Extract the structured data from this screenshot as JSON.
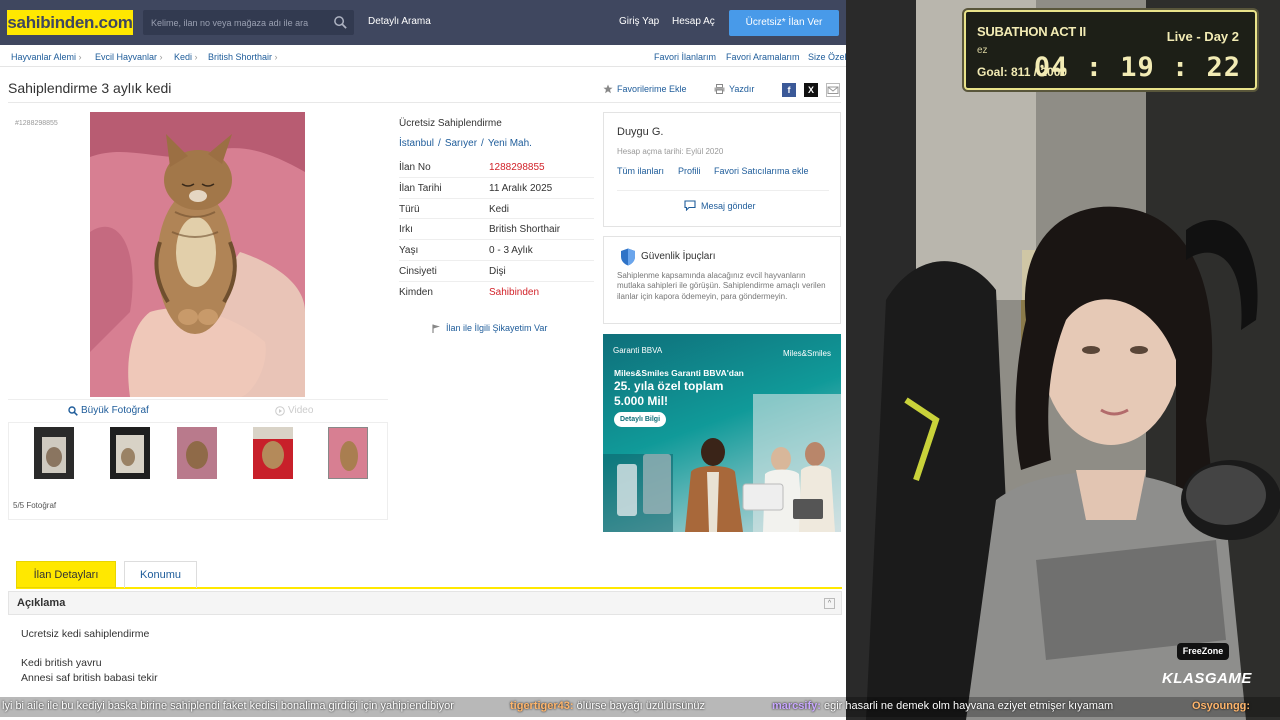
{
  "header": {
    "logo": "sahibinden.com",
    "search_placeholder": "Kelime, ilan no veya mağaza adı ile ara",
    "detailed_search": "Detaylı Arama",
    "login": "Giriş Yap",
    "register": "Hesap Aç",
    "post_ad": "Ücretsiz* İlan Ver"
  },
  "breadcrumb": {
    "items": [
      "Hayvanlar Alemi",
      "Evcil Hayvanlar",
      "Kedi",
      "British Shorthair"
    ],
    "right_links": [
      "Favori İlanlarım",
      "Favori Aramalarım",
      "Size Özel"
    ]
  },
  "listing": {
    "title": "Sahiplendirme 3 aylık kedi",
    "add_favorite": "Favorilerime Ekle",
    "print": "Yazdır",
    "id_label": "#1288298855",
    "big_photo": "Büyük Fotoğraf",
    "video": "Video",
    "photo_count": "5/5 Fotoğraf",
    "info_header": "Ücretsiz Sahiplendirme",
    "location": [
      "İstanbul",
      "Sarıyer",
      "Yeni Mah."
    ],
    "details": [
      {
        "key": "İlan No",
        "value": "1288298855",
        "accent": true
      },
      {
        "key": "İlan Tarihi",
        "value": "11 Aralık 2025",
        "accent": false
      },
      {
        "key": "Türü",
        "value": "Kedi",
        "accent": false
      },
      {
        "key": "Irkı",
        "value": "British Shorthair",
        "accent": false
      },
      {
        "key": "Yaşı",
        "value": "0 - 3 Aylık",
        "accent": false
      },
      {
        "key": "Cinsiyeti",
        "value": "Dişi",
        "accent": false
      },
      {
        "key": "Kimden",
        "value": "Sahibinden",
        "accent": true
      }
    ],
    "complaint": "İlan ile İlgili Şikayetim Var"
  },
  "seller": {
    "name": "Duygu G.",
    "since": "Hesap açma tarihi: Eylül 2020",
    "links": [
      "Tüm ilanları",
      "Profili",
      "Favori Satıcılarıma ekle"
    ],
    "message": "Mesaj gönder"
  },
  "safety": {
    "title": "Güvenlik İpuçları",
    "text": "Sahiplenme kapsamında alacağınız evcil hayvanların mutlaka sahipleri ile görüşün. Sahiplendirme amaçlı verilen ilanlar için kapora ödemeyin, para göndermeyin."
  },
  "ad": {
    "brand": "Garanti BBVA",
    "partner": "Miles&Smiles",
    "line1": "Miles&Smiles Garanti BBVA'dan",
    "line2": "25. yıla özel toplam",
    "line3": "5.000 Mil!",
    "button": "Detaylı Bilgi"
  },
  "tabs": {
    "details": "İlan Detayları",
    "location": "Konumu"
  },
  "description": {
    "title": "Açıklama",
    "lines": [
      "Ucretsiz kedi sahiplendirme",
      "Kedi british yavru",
      "Annesi saf british babasi tekir"
    ]
  },
  "stream": {
    "subathon_title": "SUBATHON ACT II",
    "live_label": "Live - Day 2",
    "sub_line": "ez",
    "goal": "Goal: 811 / 2000",
    "timer": "04 : 19 : 22",
    "freezone": "FreeZone",
    "sponsor": "KLASGAME",
    "chat": [
      {
        "user": "",
        "text": "lyi bi aile ile bu kediyi baska birine sahiplendi faket kedisi bonalima girdiği için yahipiendibiyor"
      },
      {
        "user": "tigertiger43:",
        "text": "ölürse bayağı üzülürsünüz"
      },
      {
        "user": "marcsify:",
        "text": "egir hasarli ne demek olm hayvana eziyet etmişer kıyamam"
      },
      {
        "user": "Osyoungg:",
        "text": ""
      }
    ]
  },
  "colors": {
    "header_bg": "#3f475f",
    "logo_yellow": "#ffe800",
    "link_blue": "#1e5c9a",
    "accent_red": "#d2232a",
    "post_btn": "#489ae9"
  }
}
